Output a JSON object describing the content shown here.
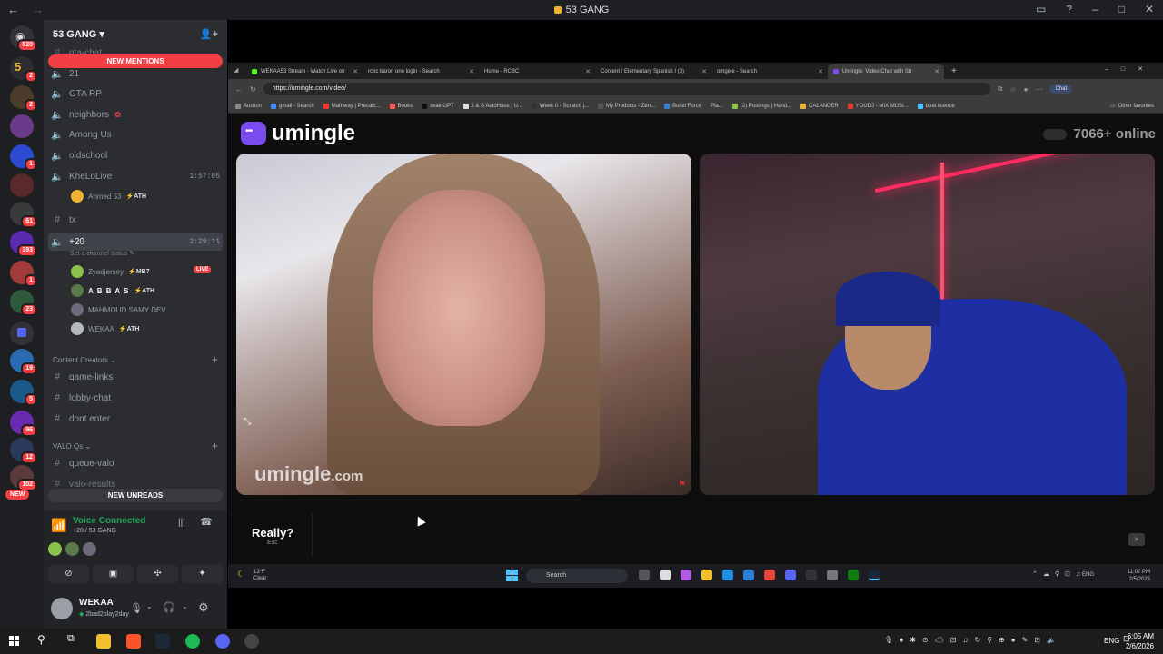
{
  "window": {
    "title": "53 GANG"
  },
  "rail": {
    "servers": [
      {
        "badge": "520"
      },
      {
        "badge": "2"
      },
      {
        "badge": "2"
      },
      {
        "badge": ""
      },
      {
        "badge": "1"
      },
      {
        "badge": ""
      },
      {
        "badge": "61"
      },
      {
        "badge": "393"
      },
      {
        "badge": "1"
      },
      {
        "badge": "23"
      },
      {
        "badge": ""
      },
      {
        "badge": "19"
      },
      {
        "badge": "5"
      },
      {
        "badge": "96"
      },
      {
        "badge": "12"
      },
      {
        "badge": "102"
      }
    ],
    "new_label": "NEW"
  },
  "server": {
    "name": "53 GANG",
    "dropdown": "▾"
  },
  "pills": {
    "new_mentions": "NEW MENTIONS",
    "new_unreads": "NEW UNREADS"
  },
  "channels": {
    "partial_top": "gta-chat",
    "voice": [
      {
        "name": "21"
      },
      {
        "name": "GTA RP"
      },
      {
        "name": "neighbors"
      },
      {
        "name": "Among Us"
      },
      {
        "name": "oldschool"
      },
      {
        "name": "KheLoLive",
        "time": "1:57:05"
      }
    ],
    "kheloLive_user": {
      "name": "Ahmed 53",
      "tag": "ATH"
    },
    "tx": "tx",
    "active": {
      "name": "+20",
      "time": "2:29:11",
      "status": "Set a channel status"
    },
    "active_users": [
      {
        "name": "Zyadjersey",
        "tag": "MB7",
        "live": "LIVE"
      },
      {
        "name": "A B B A S",
        "tag": "ATH"
      },
      {
        "name": "MAHMOUD SAMY DEV",
        "tag": ""
      },
      {
        "name": "WEKAA",
        "tag": "ATH"
      }
    ],
    "category1": "Content Creators",
    "cat1_items": [
      "game-links",
      "lobby-chat",
      "dont enter"
    ],
    "category2": "VALO Qs",
    "cat2_items": [
      "queue-valo",
      "valo-results"
    ]
  },
  "voice_panel": {
    "status": "Voice Connected",
    "location": "+20 / 53 GANG"
  },
  "user_panel": {
    "name": "WEKAA",
    "status": "2bad2play2day"
  },
  "browser": {
    "tabs": [
      {
        "label": "WEKAA53 Stream - Watch Live on",
        "color": "#53fc18"
      },
      {
        "label": "rcbc baron one login - Search",
        "color": ""
      },
      {
        "label": "Home - RCBC",
        "color": ""
      },
      {
        "label": "Content / Elementary Spanish I (3)",
        "color": ""
      },
      {
        "label": "omgele - Search",
        "color": ""
      },
      {
        "label": "Umingle: Video Chat with Str",
        "color": "#7a4cf0"
      }
    ],
    "url": "https://umingle.com/video/",
    "chat_button": "Chat",
    "bookmarks": [
      {
        "label": "Auction",
        "color": "#888"
      },
      {
        "label": "gmail - Search",
        "color": "#4285f4"
      },
      {
        "label": "Mathway | Precalc...",
        "color": "#e33"
      },
      {
        "label": "Books",
        "color": "#f55"
      },
      {
        "label": "twainGPT",
        "color": "#111"
      },
      {
        "label": "J & S AutoHaus | U...",
        "color": "#ddd"
      },
      {
        "label": "Week 0 - Scratch |...",
        "color": "#333"
      },
      {
        "label": "My Products - Zen...",
        "color": "#555"
      },
      {
        "label": "Bullet Force",
        "color": "#3a7bd5"
      },
      {
        "label": "Pla...",
        "color": ""
      },
      {
        "label": "(2) Postings | Hand...",
        "color": "#8bc34a"
      },
      {
        "label": "CALANDER",
        "color": "#f0b232"
      },
      {
        "label": "YOUDJ - MIX MUSI...",
        "color": "#e33"
      },
      {
        "label": "boat licence",
        "color": "#4cc2ff"
      }
    ],
    "other_favorites": "Other favorites"
  },
  "umingle": {
    "brand": "umingle",
    "online_count": "7066+ online",
    "watermark_main": "umingle",
    "watermark_tld": ".com",
    "reply_text": "Really?",
    "reply_hint": "Esc"
  },
  "inner_taskbar": {
    "weather_temp": "13°F",
    "weather_desc": "Clear",
    "search": "Search",
    "lang": "ENG",
    "time": "11:07 PM",
    "date": "2/5/2026"
  },
  "taskbar": {
    "lang": "ENG",
    "time": "6:05 AM",
    "date": "2/6/2026"
  }
}
